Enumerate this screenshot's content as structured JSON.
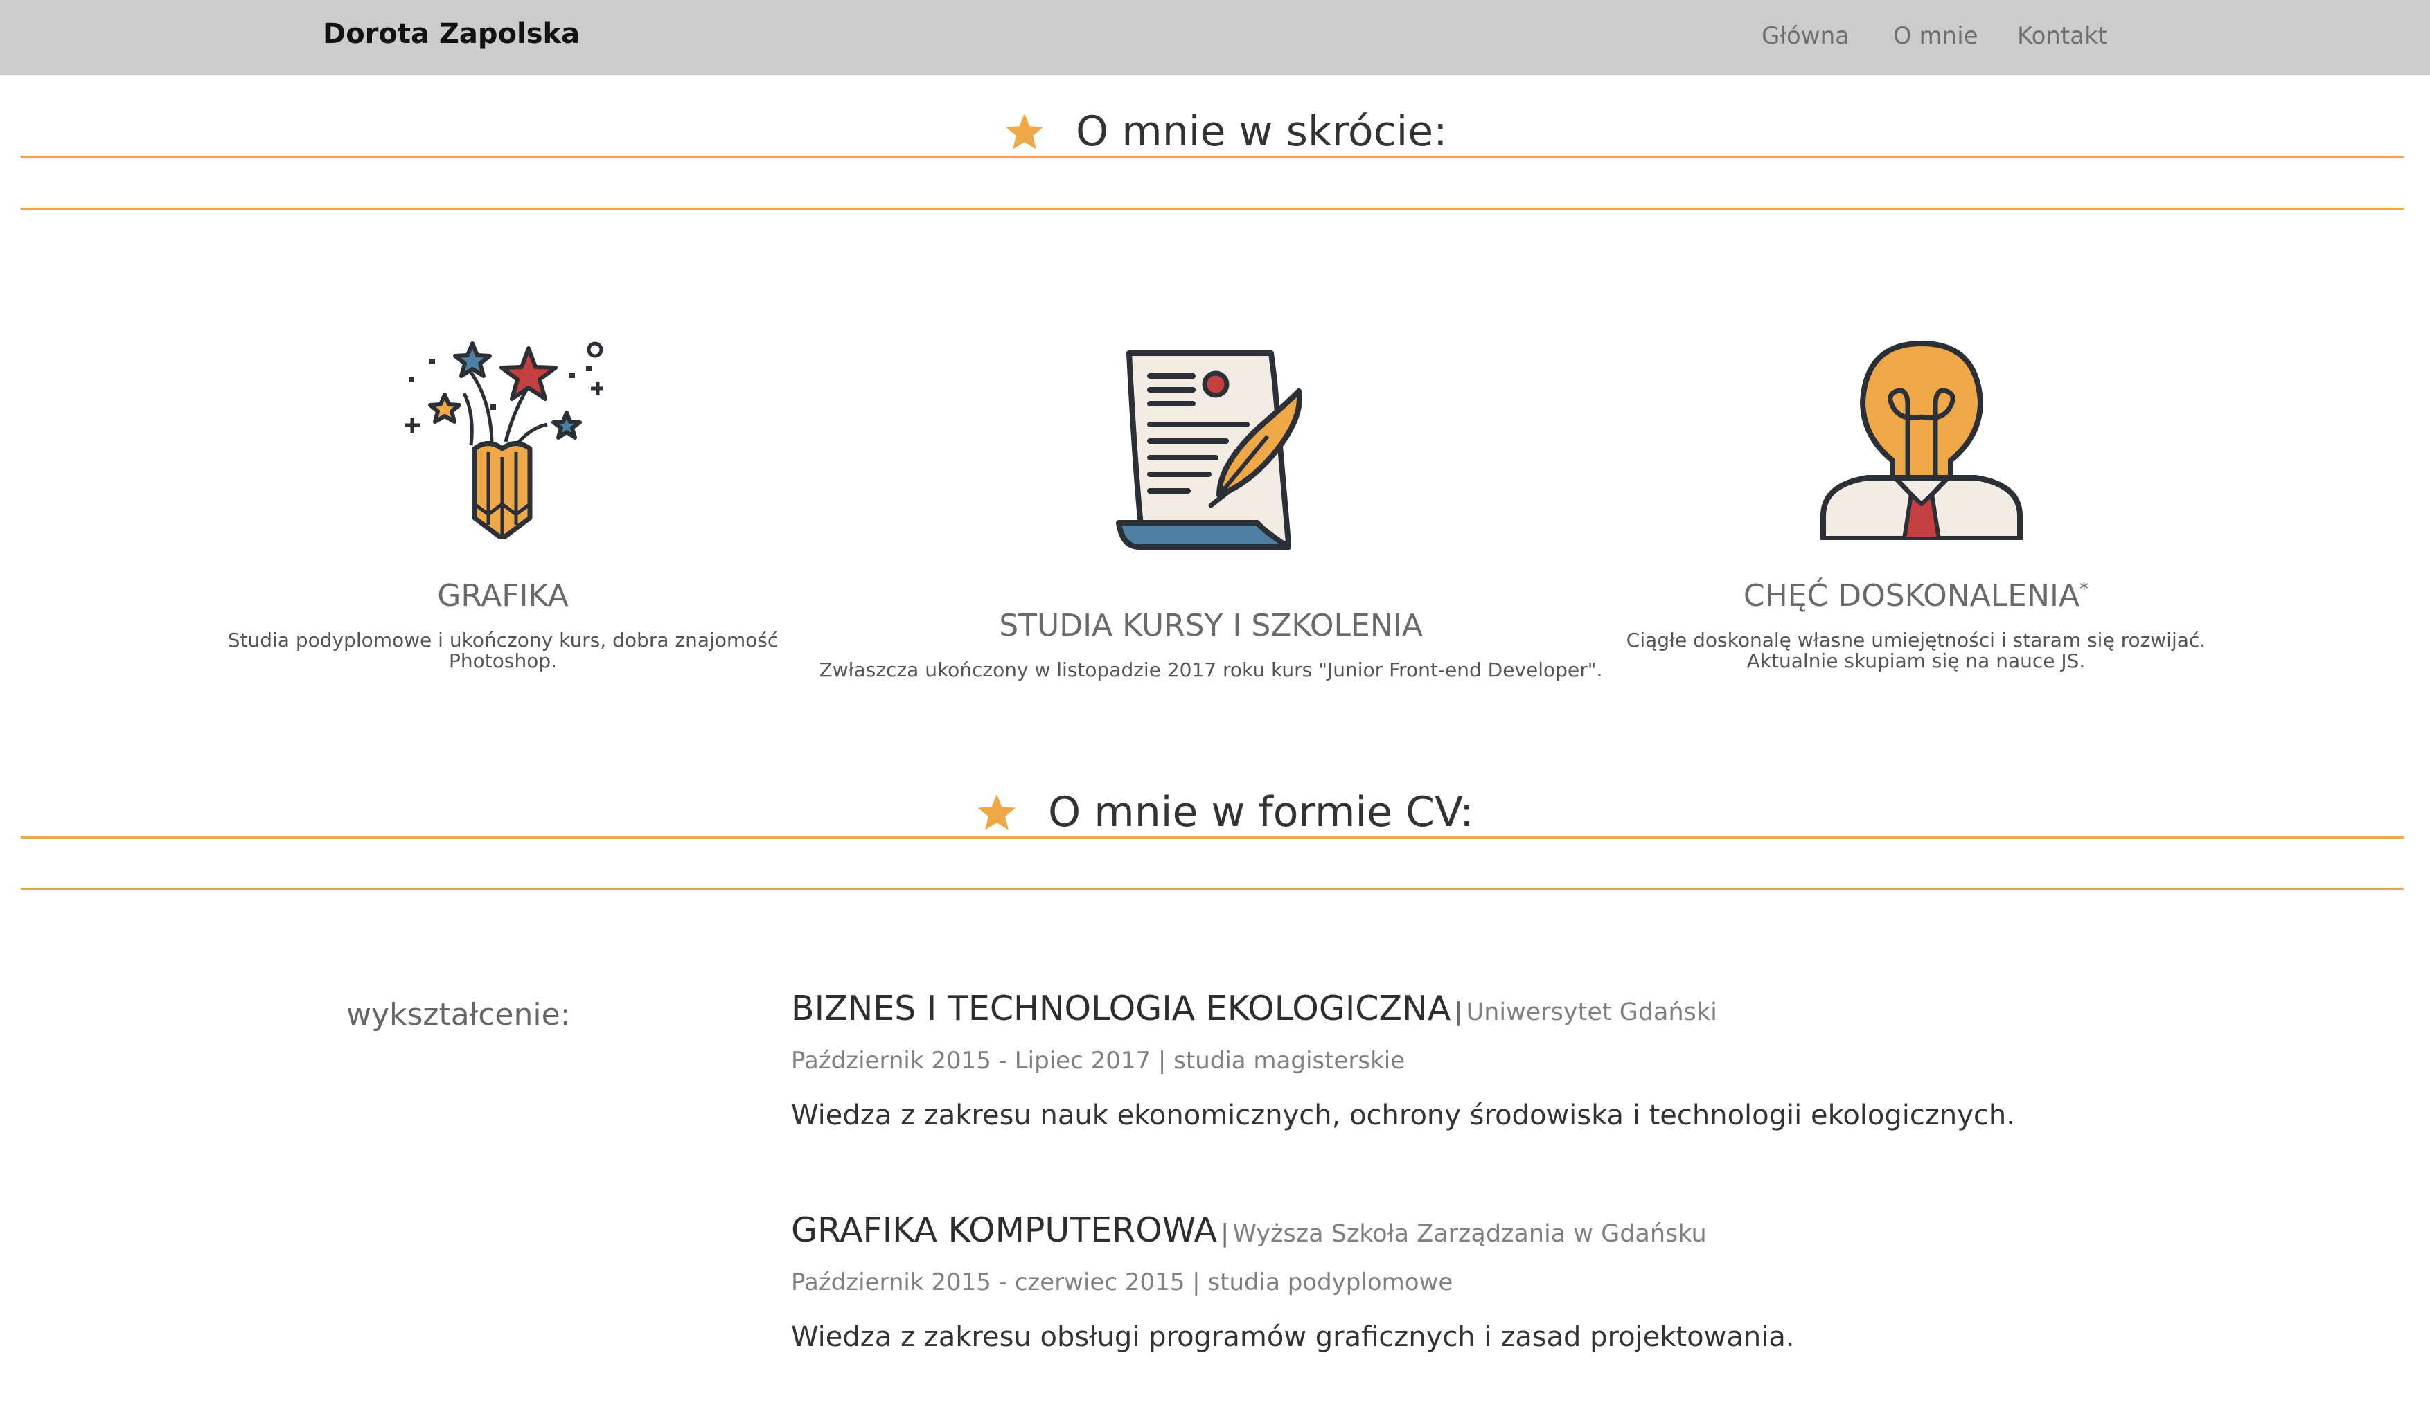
{
  "nav": {
    "brand": "Dorota Zapolska",
    "links": [
      "Główna",
      "O mnie",
      "Kontakt"
    ]
  },
  "colors": {
    "accent": "#efa848",
    "navbar_bg": "#cccccc",
    "icon_dark": "#2b2f36",
    "icon_red": "#c43f3f",
    "icon_blue": "#4f7fa3",
    "icon_cream": "#f2ece4"
  },
  "about": {
    "title": "O mnie w skrócie:",
    "title_icon": "star-icon",
    "features": [
      {
        "icon": "pencil-fireworks-icon",
        "title": "GRAFIKA",
        "desc_lines": [
          "Studia podyplomowe i ukończony kurs, dobra znajomość",
          "Photoshop."
        ]
      },
      {
        "icon": "document-quill-icon",
        "title": "STUDIA KURSY I SZKOLENIA",
        "desc_lines": [
          "Zwłaszcza ukończony w listopadzie 2017 roku kurs \"Junior Front-end Developer\"."
        ]
      },
      {
        "icon": "lightbulb-head-icon",
        "title": "CHĘĆ DOSKONALENIA",
        "title_sup": "*",
        "desc_lines": [
          "Ciągłe doskonalę własne umiejętności i staram się rozwijać.",
          "Aktualnie skupiam się na nauce JS."
        ]
      }
    ]
  },
  "cv": {
    "title": "O mnie w formie CV:",
    "title_icon": "star-icon",
    "education_label": "wykształcenie:",
    "entries": [
      {
        "title": "BIZNES I TECHNOLOGIA EKOLOGICZNA",
        "separator": "|",
        "school": "Uniwersytet Gdański",
        "meta": "Październik 2015 - Lipiec 2017 | studia magisterskie",
        "desc": "Wiedza z zakresu nauk ekonomicznych, ochrony środowiska i technologii ekologicznych."
      },
      {
        "title": "GRAFIKA KOMPUTEROWA",
        "separator": "|",
        "school": "Wyższa Szkoła Zarządzania w Gdańsku",
        "meta": "Październik 2015 - czerwiec 2015 | studia podyplomowe",
        "desc": "Wiedza z zakresu obsługi programów graficznych i zasad projektowania."
      }
    ]
  }
}
